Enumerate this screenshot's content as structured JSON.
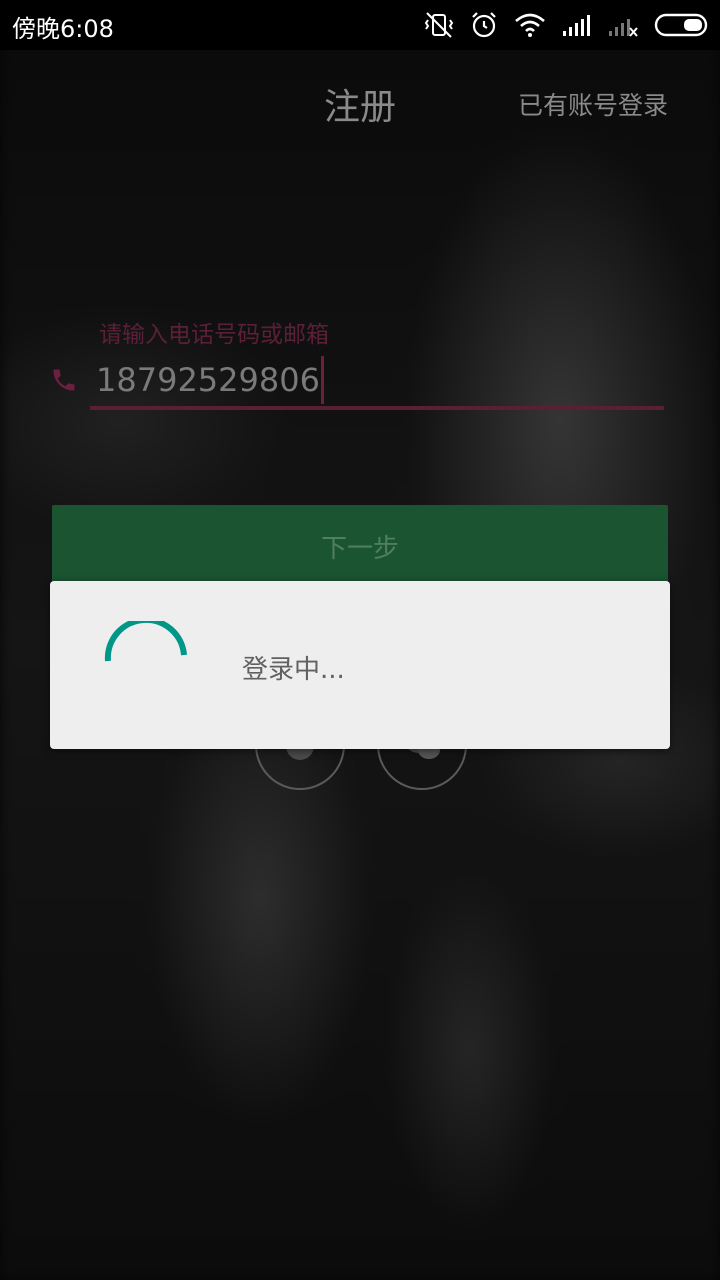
{
  "status_bar": {
    "time": "傍晚6:08"
  },
  "header": {
    "title": "注册",
    "login_link": "已有账号登录"
  },
  "form": {
    "field_label": "请输入电话号码或邮箱",
    "phone_value": "18792529806",
    "next_button": "下一步"
  },
  "dialog": {
    "message": "登录中..."
  },
  "colors": {
    "accent": "#6e1f3f",
    "button_bg": "#1a5430",
    "spinner": "#009688",
    "dialog_bg": "#eeeeee"
  },
  "icons": {
    "status": [
      "vibrate-off-icon",
      "alarm-icon",
      "wifi-icon",
      "signal-icon",
      "signal-no-sim-icon",
      "battery-icon"
    ],
    "field": "phone-icon",
    "social": [
      "qq-icon",
      "wechat-icon"
    ]
  }
}
